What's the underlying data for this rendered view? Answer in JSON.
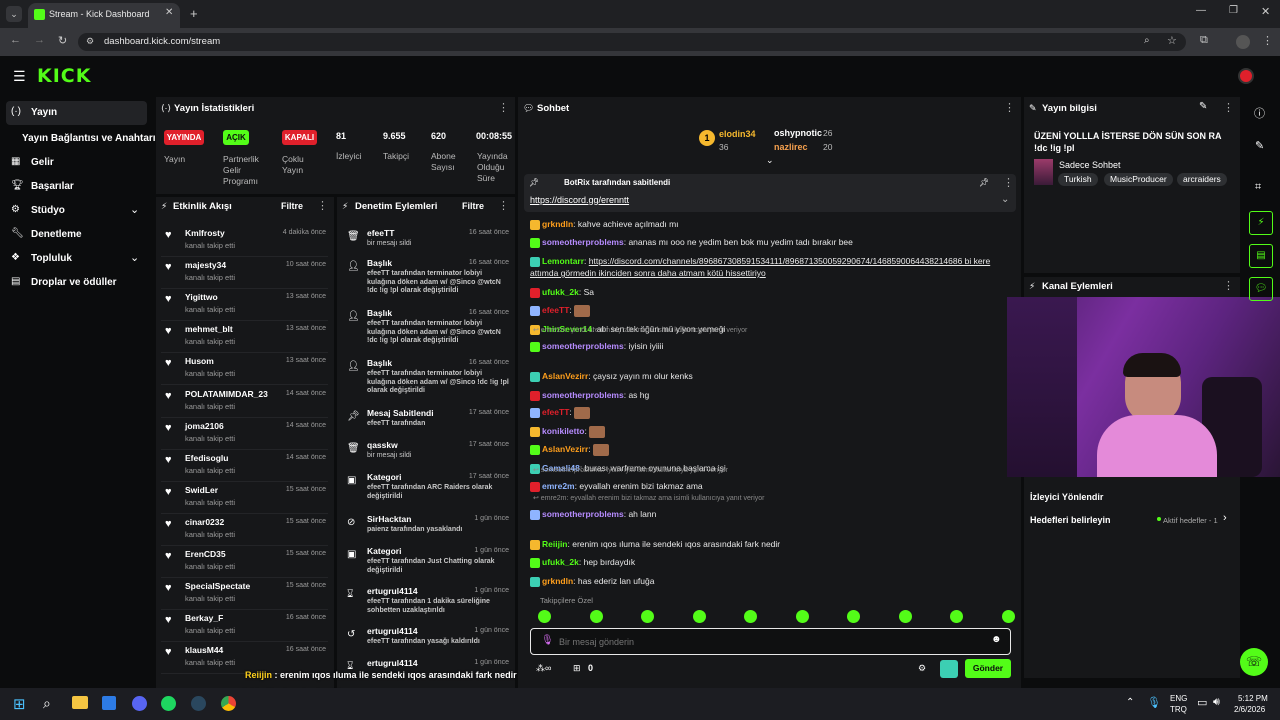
{
  "browser": {
    "tab_title": "Stream - Kick Dashboard",
    "url": "dashboard.kick.com/stream"
  },
  "brand": {
    "logo": "KICK",
    "accent": "#53fc18"
  },
  "sidebar": {
    "items": [
      {
        "label": "Yayın",
        "icon": "broadcast-icon"
      },
      {
        "label": "Yayın Bağlantısı ve Anahtarı",
        "icon": ""
      },
      {
        "label": "Gelir",
        "icon": "revenue-icon"
      },
      {
        "label": "Başarılar",
        "icon": "trophy-icon"
      },
      {
        "label": "Stüdyo",
        "icon": "studio-icon"
      },
      {
        "label": "Denetleme",
        "icon": "wrench-icon"
      },
      {
        "label": "Topluluk",
        "icon": "community-icon"
      },
      {
        "label": "Droplar ve ödüller",
        "icon": "drops-icon"
      }
    ]
  },
  "stats": {
    "title": "Yayın İstatistikleri",
    "status": [
      {
        "value": "YAYINDA",
        "label": "Yayın",
        "color": "#e0202b"
      },
      {
        "value": "AÇIK",
        "label": "Partnerlik Gelir Programı",
        "color": "#53fc18"
      },
      {
        "value": "KAPALI",
        "label": "Çoklu Yayın",
        "color": "#e0202b"
      }
    ],
    "numbers": [
      {
        "value": "81",
        "label": "İzleyici"
      },
      {
        "value": "9.655",
        "label": "Takipçi"
      },
      {
        "value": "620",
        "label": "Abone Sayısı"
      },
      {
        "value": "00:08:55",
        "label": "Yayında Olduğu Süre"
      }
    ]
  },
  "activity": {
    "title": "Etkinlik Akışı",
    "filter": "Filtre",
    "items": [
      {
        "name": "Kmlfrosty",
        "sub": "kanalı takip etti",
        "time": "4 dakika önce"
      },
      {
        "name": "majesty34",
        "sub": "kanalı takip etti",
        "time": "10 saat önce"
      },
      {
        "name": "Yigittwo",
        "sub": "kanalı takip etti",
        "time": "13 saat önce"
      },
      {
        "name": "mehmet_blt",
        "sub": "kanalı takip etti",
        "time": "13 saat önce"
      },
      {
        "name": "Husom",
        "sub": "kanalı takip etti",
        "time": "13 saat önce"
      },
      {
        "name": "POLATAMIMDAR_23",
        "sub": "kanalı takip etti",
        "time": "14 saat önce"
      },
      {
        "name": "joma2106",
        "sub": "kanalı takip etti",
        "time": "14 saat önce"
      },
      {
        "name": "Efedisoglu",
        "sub": "kanalı takip etti",
        "time": "14 saat önce"
      },
      {
        "name": "SwidLer",
        "sub": "kanalı takip etti",
        "time": "15 saat önce"
      },
      {
        "name": "cinar0232",
        "sub": "kanalı takip etti",
        "time": "15 saat önce"
      },
      {
        "name": "ErenCD35",
        "sub": "kanalı takip etti",
        "time": "15 saat önce"
      },
      {
        "name": "SpecialSpectate",
        "sub": "kanalı takip etti",
        "time": "15 saat önce"
      },
      {
        "name": "Berkay_F",
        "sub": "kanalı takip etti",
        "time": "16 saat önce"
      },
      {
        "name": "klausM44",
        "sub": "kanalı takip etti",
        "time": "16 saat önce"
      }
    ]
  },
  "moderation": {
    "title": "Denetim Eylemleri",
    "filter": "Filtre",
    "items": [
      {
        "title": "efeeTT",
        "body": "bir mesajı sildi",
        "time": "16 saat önce",
        "icon": "trash-icon"
      },
      {
        "title": "Başlık",
        "body": "efeeTT tarafından terminator lobiyi kulağına döken adam w/ @Sinco @wtcN !dc !ig !pl olarak değiştirildi",
        "time": "16 saat önce",
        "icon": "user-edit-icon"
      },
      {
        "title": "Başlık",
        "body": "efeeTT tarafından terminator lobiyi kulağına döken adam w/ @Sinco @wtcN !dc !ig !pl olarak değiştirildi",
        "time": "16 saat önce",
        "icon": "user-edit-icon"
      },
      {
        "title": "Başlık",
        "body": "efeeTT tarafından terminator lobiyi kulağına döken adam w/ @Sinco !dc !ig !pl olarak değiştirildi",
        "time": "16 saat önce",
        "icon": "user-edit-icon"
      },
      {
        "title": "Mesaj Sabitlendi",
        "body": "efeeTT tarafından",
        "time": "17 saat önce",
        "icon": "pin-icon"
      },
      {
        "title": "qasskw",
        "body": "bir mesajı sildi",
        "time": "17 saat önce",
        "icon": "trash-icon"
      },
      {
        "title": "Kategori",
        "body": "efeeTT tarafından ARC Raiders olarak değiştirildi",
        "time": "17 saat önce",
        "icon": "category-icon"
      },
      {
        "title": "SirHacktan",
        "body": "paienz tarafından yasaklandı",
        "time": "1 gün önce",
        "icon": "ban-icon"
      },
      {
        "title": "Kategori",
        "body": "efeeTT tarafından Just Chatting olarak değiştirildi",
        "time": "1 gün önce",
        "icon": "category-icon"
      },
      {
        "title": "ertugrul4114",
        "body": "efeeTT tarafından 1 dakika süreliğine sohbetten uzaklaştırıldı",
        "time": "1 gün önce",
        "icon": "hourglass-icon"
      },
      {
        "title": "ertugrul4114",
        "body": "efeeTT tarafından yasağı kaldırıldı",
        "time": "1 gün önce",
        "icon": "undo-icon"
      },
      {
        "title": "ertugrul4114",
        "body": "",
        "time": "1 gün önce",
        "icon": "hourglass-icon"
      }
    ]
  },
  "chat": {
    "title": "Sohbet",
    "leaders": [
      {
        "name": "elodin34",
        "count": "36"
      },
      {
        "name": "oshypnotic",
        "count": "26"
      },
      {
        "name": "nazlirec",
        "count": "20"
      }
    ],
    "pinned": {
      "by": "BotRix tarafından sabitlendi",
      "link": "https://discord.gg/erenntt"
    },
    "messages": [
      {
        "user": "grkndln",
        "text": "kahve achieve açılmadı mı",
        "color": "#ff9f1c",
        "reply": ""
      },
      {
        "user": "someotherproblems",
        "text": "ananas mı ooo ne yedim ben bok mu yedim tadı bırakır bee",
        "color": "#b78cff",
        "reply": ""
      },
      {
        "user": "Lemontarr",
        "text": "https://discord.com/channels/896867308591534111/896871350059290674/1468590064438214686 bi kere attımda görmedin ikinciden sonra daha atmam kötü hissettiriyo",
        "color": "#53fc18",
        "reply": ""
      },
      {
        "user": "ufukk_2k",
        "text": "Sa",
        "color": "#53fc18",
        "reply": ""
      },
      {
        "user": "efeeTT",
        "text": "",
        "color": "#e0202b",
        "reply": ""
      },
      {
        "user": "JhinSever14",
        "text": "abi sen tek öğün mü yiyon yemeği",
        "color": "#53fc18",
        "reply": ""
      },
      {
        "user": "someotherproblems",
        "text": "iyisin iyiiii",
        "color": "#b78cff",
        "reply": "emre2m: şimdi ürettim hiç takılmadık isimli kullanıcıya yanıt veriyor"
      },
      {
        "user": "AslanVezirr",
        "text": "çaysız yayın mı olur kenks",
        "color": "#ff9f1c",
        "reply": ""
      },
      {
        "user": "someotherproblems",
        "text": "as hg",
        "color": "#b78cff",
        "reply": ""
      },
      {
        "user": "efeeTT",
        "text": "",
        "color": "#e0202b",
        "reply": ""
      },
      {
        "user": "konikiletto",
        "text": "",
        "color": "#b78cff",
        "reply": ""
      },
      {
        "user": "AslanVezirr",
        "text": "",
        "color": "#ff9f1c",
        "reply": ""
      },
      {
        "user": "Gamali48",
        "text": "burası warframe oyununa başlama işi",
        "color": "#8fb4ff",
        "reply": ""
      },
      {
        "user": "emre2m",
        "text": "eyvallah erenim bizi takmaz ama",
        "color": "#8fb4ff",
        "reply": "someotherproblems: iyisin iyiiii isimli kullanıcıya yanıt veriyor"
      },
      {
        "user": "someotherproblems",
        "text": "ah lann",
        "color": "#b78cff",
        "reply": "emre2m: eyvallah erenim bizi takmaz ama isimli kullanıcıya yanıt veriyor"
      },
      {
        "user": "Reiijin",
        "text": "erenim ıqos ıluma ile sendeki ıqos arasındaki fark nedir",
        "color": "#53fc18",
        "reply": ""
      },
      {
        "user": "ufukk_2k",
        "text": "hep bırdaydık",
        "color": "#53fc18",
        "reply": ""
      },
      {
        "user": "grkndln",
        "text": "has ederiz lan ufuğa",
        "color": "#ff9f1c",
        "reply": ""
      }
    ],
    "followers_label": "Takipçilere Özel",
    "input_placeholder": "Bir mesaj gönderin",
    "points": "0",
    "send_label": "Gönder"
  },
  "stream_info": {
    "title": "Yayın bilgisi",
    "stream_title": "ÜZENİ YOLLLA İSTERSE DÖN SÜN SON RA !dc !ig !pl",
    "category": "Sadece Sohbet",
    "tags": [
      "Turkish",
      "MusicProducer",
      "arcraiders"
    ]
  },
  "channel_actions": {
    "title": "Kanal Eylemleri",
    "items": [
      {
        "label": "İzleyici Yönlendir",
        "value": ""
      },
      {
        "label": "Hedefleri belirleyin",
        "value": "Aktif hedefler - 1"
      }
    ]
  },
  "overlay": {
    "lines": [
      {
        "user": "Reiijin",
        "text": "erenim ıqos ıluma ile sendeki ıqos arasındaki fark nedir"
      },
      {
        "user": "ufukk_2k",
        "text": "hep bırdaydık"
      },
      {
        "user": "grkndln",
        "text": "has ederiz lan ufuğa"
      }
    ]
  },
  "taskbar": {
    "lang": "ENG",
    "region": "TRQ",
    "time": "5:12 PM",
    "date": "2/6/2026"
  }
}
